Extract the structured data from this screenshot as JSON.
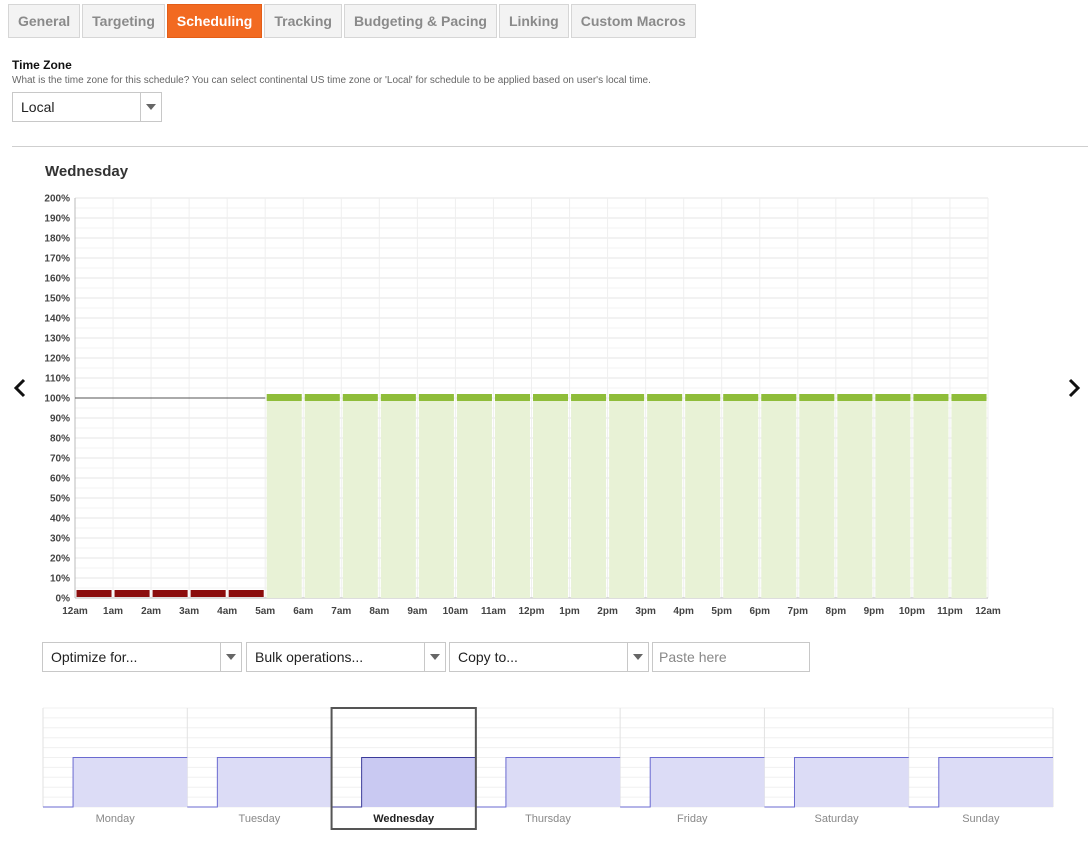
{
  "tabs": [
    {
      "label": "General",
      "active": false
    },
    {
      "label": "Targeting",
      "active": false
    },
    {
      "label": "Scheduling",
      "active": true
    },
    {
      "label": "Tracking",
      "active": false
    },
    {
      "label": "Budgeting & Pacing",
      "active": false
    },
    {
      "label": "Linking",
      "active": false
    },
    {
      "label": "Custom Macros",
      "active": false
    }
  ],
  "timezone": {
    "title": "Time Zone",
    "description": "What is the time zone for this schedule? You can select continental US time zone or 'Local' for schedule to be applied based on user's local time.",
    "selected": "Local"
  },
  "nav": {
    "prev_icon": "chevron-left-icon",
    "next_icon": "chevron-right-icon"
  },
  "controls": {
    "optimize": "Optimize for...",
    "bulk": "Bulk operations...",
    "copy": "Copy to...",
    "paste_placeholder": "Paste here"
  },
  "colors": {
    "accent_tab": "#f26a21",
    "bar_on": "#e8f2d6",
    "bar_on_top": "#8fbd3a",
    "bar_off": "#8b0d0d",
    "overview_fill": "#dcdcf6",
    "overview_line": "#6a6ad0"
  },
  "chart_data": [
    {
      "type": "bar",
      "title": "Wednesday",
      "categories": [
        "12am",
        "1am",
        "2am",
        "3am",
        "4am",
        "5am",
        "6am",
        "7am",
        "8am",
        "9am",
        "10am",
        "11am",
        "12pm",
        "1pm",
        "2pm",
        "3pm",
        "4pm",
        "5pm",
        "6pm",
        "7pm",
        "8pm",
        "9pm",
        "10pm",
        "11pm"
      ],
      "values": [
        0,
        0,
        0,
        0,
        0,
        100,
        100,
        100,
        100,
        100,
        100,
        100,
        100,
        100,
        100,
        100,
        100,
        100,
        100,
        100,
        100,
        100,
        100,
        100
      ],
      "x_tick_labels": [
        "12am",
        "1am",
        "2am",
        "3am",
        "4am",
        "5am",
        "6am",
        "7am",
        "8am",
        "9am",
        "10am",
        "11am",
        "12pm",
        "1pm",
        "2pm",
        "3pm",
        "4pm",
        "5pm",
        "6pm",
        "7pm",
        "8pm",
        "9pm",
        "10pm",
        "11pm",
        "12am"
      ],
      "y_tick_labels": [
        "0%",
        "10%",
        "20%",
        "30%",
        "40%",
        "50%",
        "60%",
        "70%",
        "80%",
        "90%",
        "100%",
        "110%",
        "120%",
        "130%",
        "140%",
        "150%",
        "160%",
        "170%",
        "180%",
        "190%",
        "200%"
      ],
      "ylim": [
        0,
        200
      ],
      "grid": true,
      "reference_line": 100
    },
    {
      "type": "area",
      "days": [
        "Monday",
        "Tuesday",
        "Wednesday",
        "Thursday",
        "Friday",
        "Saturday",
        "Sunday"
      ],
      "selected_day": "Wednesday",
      "series": [
        {
          "day": "Monday",
          "values": [
            0,
            0,
            0,
            0,
            0,
            100,
            100,
            100,
            100,
            100,
            100,
            100,
            100,
            100,
            100,
            100,
            100,
            100,
            100,
            100,
            100,
            100,
            100,
            100
          ]
        },
        {
          "day": "Tuesday",
          "values": [
            0,
            0,
            0,
            0,
            0,
            100,
            100,
            100,
            100,
            100,
            100,
            100,
            100,
            100,
            100,
            100,
            100,
            100,
            100,
            100,
            100,
            100,
            100,
            100
          ]
        },
        {
          "day": "Wednesday",
          "values": [
            0,
            0,
            0,
            0,
            0,
            100,
            100,
            100,
            100,
            100,
            100,
            100,
            100,
            100,
            100,
            100,
            100,
            100,
            100,
            100,
            100,
            100,
            100,
            100
          ]
        },
        {
          "day": "Thursday",
          "values": [
            0,
            0,
            0,
            0,
            0,
            100,
            100,
            100,
            100,
            100,
            100,
            100,
            100,
            100,
            100,
            100,
            100,
            100,
            100,
            100,
            100,
            100,
            100,
            100
          ]
        },
        {
          "day": "Friday",
          "values": [
            0,
            0,
            0,
            0,
            0,
            100,
            100,
            100,
            100,
            100,
            100,
            100,
            100,
            100,
            100,
            100,
            100,
            100,
            100,
            100,
            100,
            100,
            100,
            100
          ]
        },
        {
          "day": "Saturday",
          "values": [
            0,
            0,
            0,
            0,
            0,
            100,
            100,
            100,
            100,
            100,
            100,
            100,
            100,
            100,
            100,
            100,
            100,
            100,
            100,
            100,
            100,
            100,
            100,
            100
          ]
        },
        {
          "day": "Sunday",
          "values": [
            0,
            0,
            0,
            0,
            0,
            100,
            100,
            100,
            100,
            100,
            100,
            100,
            100,
            100,
            100,
            100,
            100,
            100,
            100,
            100,
            100,
            100,
            100,
            100
          ]
        }
      ],
      "ylim": [
        0,
        200
      ]
    }
  ]
}
